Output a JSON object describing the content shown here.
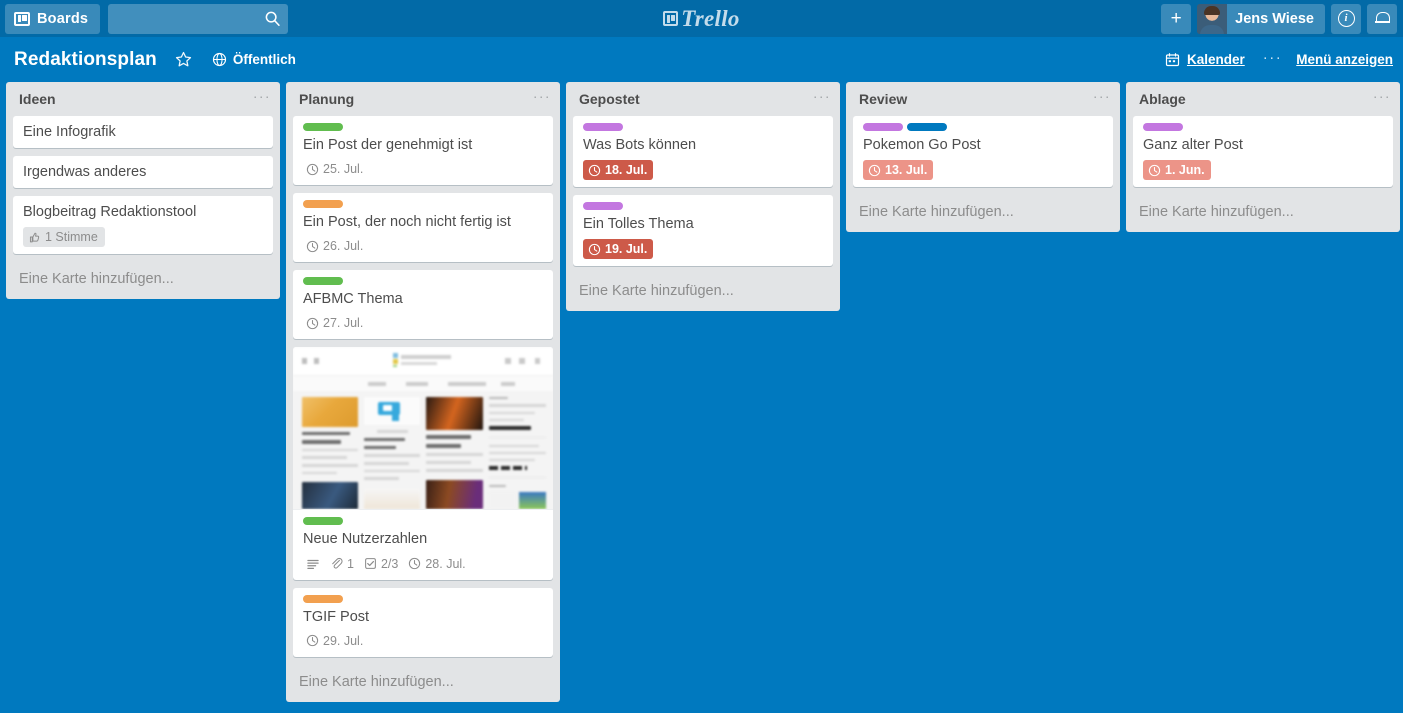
{
  "top_bar": {
    "boards_button": "Boards",
    "boards_icon": "board-icon",
    "search_placeholder": "",
    "search_value": "",
    "search_icon": "search-icon",
    "logo_text": "Trello",
    "logo_icon": "trello-board-icon",
    "add_button": "+",
    "member_name": "Jens Wiese",
    "avatar_icon": "user-avatar",
    "info_button": "i",
    "info_icon": "info-circle-icon",
    "notifications_icon": "bell-icon"
  },
  "board_header": {
    "title": "Redaktionsplan",
    "star_icon": "star-icon",
    "visibility_icon": "globe-icon",
    "visibility_label": "Öffentlich",
    "calendar_icon": "calendar-icon",
    "calendar_label": "Kalender",
    "menu_dots": "···",
    "menu_label": "Menü anzeigen"
  },
  "colors": {
    "brand_blue": "#0079bf",
    "top_bar_blue": "#026aa7",
    "list_grey": "#e2e4e6",
    "card_white": "#ffffff",
    "label_green": "#61bd4f",
    "label_orange": "#f2a04f",
    "label_purple": "#c377e0",
    "label_blue": "#0079bf",
    "due_red": "#cd5a49",
    "due_red_soft": "#ec9488",
    "text_grey": "#4d4d4d",
    "muted_grey": "#8c8c8c"
  },
  "add_card_label": "Eine Karte hinzufügen...",
  "list_menu_dots": "···",
  "lists": [
    {
      "title": "Ideen",
      "cards": [
        {
          "title": "Eine Infografik",
          "labels": [],
          "badges": []
        },
        {
          "title": "Irgendwas anderes",
          "labels": [],
          "badges": []
        },
        {
          "title": "Blogbeitrag Redaktionstool",
          "labels": [],
          "badges": [
            {
              "type": "vote",
              "icon": "thumbs-up-icon",
              "text": "1 Stimme"
            }
          ]
        }
      ]
    },
    {
      "title": "Planung",
      "cards": [
        {
          "title": "Ein Post der genehmigt ist",
          "labels": [
            "#61bd4f"
          ],
          "badges": [
            {
              "type": "due",
              "icon": "clock-icon",
              "text": "25. Jul."
            }
          ]
        },
        {
          "title": "Ein Post, der noch nicht fertig ist",
          "labels": [
            "#f2a04f"
          ],
          "badges": [
            {
              "type": "due",
              "icon": "clock-icon",
              "text": "26. Jul."
            }
          ]
        },
        {
          "title": "AFBMC Thema",
          "labels": [
            "#61bd4f"
          ],
          "badges": [
            {
              "type": "due",
              "icon": "clock-icon",
              "text": "27. Jul."
            }
          ]
        },
        {
          "title": "Neue Nutzerzahlen",
          "cover": "website-screenshot",
          "labels": [
            "#61bd4f"
          ],
          "badges": [
            {
              "type": "desc",
              "icon": "description-icon",
              "text": ""
            },
            {
              "type": "attachment",
              "icon": "paperclip-icon",
              "text": "1"
            },
            {
              "type": "checklist",
              "icon": "checkbox-icon",
              "text": "2/3"
            },
            {
              "type": "due",
              "icon": "clock-icon",
              "text": "28. Jul."
            }
          ]
        },
        {
          "title": "TGIF Post",
          "labels": [
            "#f2a04f"
          ],
          "badges": [
            {
              "type": "due",
              "icon": "clock-icon",
              "text": "29. Jul."
            }
          ]
        }
      ]
    },
    {
      "title": "Gepostet",
      "cards": [
        {
          "title": "Was Bots können",
          "labels": [
            "#c377e0"
          ],
          "badges": [
            {
              "type": "due-overdue",
              "icon": "clock-icon",
              "text": "18. Jul."
            }
          ]
        },
        {
          "title": "Ein Tolles Thema",
          "labels": [
            "#c377e0"
          ],
          "badges": [
            {
              "type": "due-overdue",
              "icon": "clock-icon",
              "text": "19. Jul."
            }
          ]
        }
      ]
    },
    {
      "title": "Review",
      "cards": [
        {
          "title": "Pokemon Go Post",
          "labels": [
            "#c377e0",
            "#0079bf"
          ],
          "badges": [
            {
              "type": "due-overdue-soft",
              "icon": "clock-icon",
              "text": "13. Jul."
            }
          ]
        }
      ]
    },
    {
      "title": "Ablage",
      "cards": [
        {
          "title": "Ganz alter Post",
          "labels": [
            "#c377e0"
          ],
          "badges": [
            {
              "type": "due-overdue-soft",
              "icon": "clock-icon",
              "text": "1. Jun."
            }
          ]
        }
      ]
    }
  ]
}
